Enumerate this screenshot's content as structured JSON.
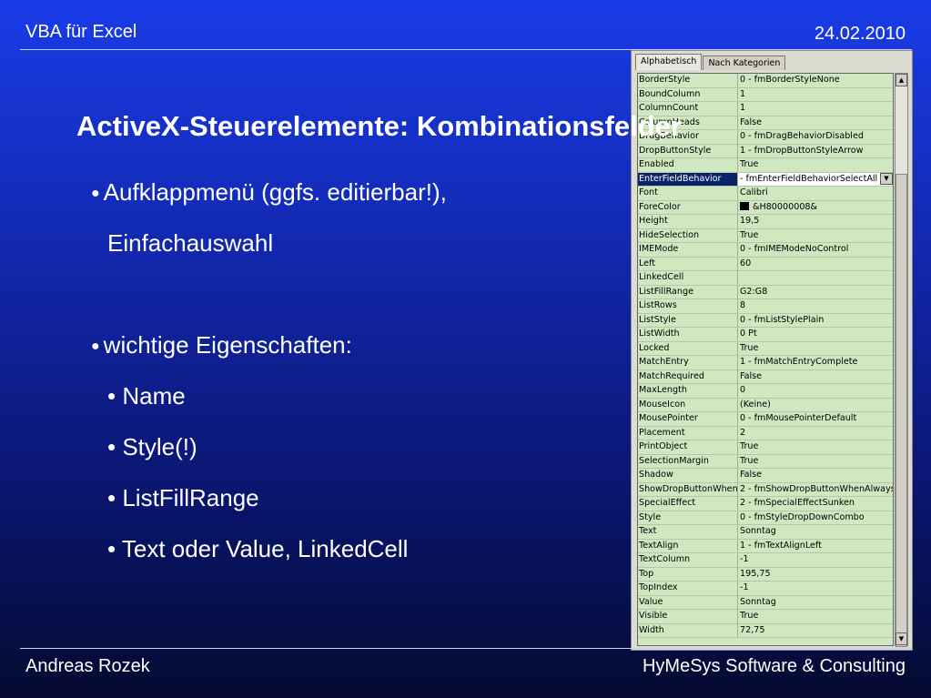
{
  "header": {
    "left": "VBA für Excel",
    "right": "24.02.2010"
  },
  "slide": {
    "title": "ActiveX-Steuerelemente: Kombinationsfelder",
    "bullet1_line1": "Aufklappmenü (ggfs. editierbar!),",
    "bullet1_line2": "Einfachauswahl",
    "bullet2": "wichtige Eigenschaften:",
    "sub": [
      "• Name",
      "• Style(!)",
      "• ListFillRange",
      "• Text oder Value, LinkedCell"
    ]
  },
  "properties": {
    "tabs": [
      "Alphabetisch",
      "Nach Kategorien"
    ],
    "rows": [
      {
        "name": "BorderStyle",
        "value": "0 - fmBorderStyleNone"
      },
      {
        "name": "BoundColumn",
        "value": "1"
      },
      {
        "name": "ColumnCount",
        "value": "1"
      },
      {
        "name": "ColumnHeads",
        "value": "False"
      },
      {
        "name": "DragBehavior",
        "value": "0 - fmDragBehaviorDisabled"
      },
      {
        "name": "DropButtonStyle",
        "value": "1 - fmDropButtonStyleArrow"
      },
      {
        "name": "Enabled",
        "value": "True"
      },
      {
        "name": "EnterFieldBehavior",
        "value": " - fmEnterFieldBehaviorSelectAll"
      },
      {
        "name": "Font",
        "value": "Calibri"
      },
      {
        "name": "ForeColor",
        "value": "&H80000008&"
      },
      {
        "name": "Height",
        "value": "19,5"
      },
      {
        "name": "HideSelection",
        "value": "True"
      },
      {
        "name": "IMEMode",
        "value": "0 - fmIMEModeNoControl"
      },
      {
        "name": "Left",
        "value": "60"
      },
      {
        "name": "LinkedCell",
        "value": ""
      },
      {
        "name": "ListFillRange",
        "value": "G2:G8"
      },
      {
        "name": "ListRows",
        "value": "8"
      },
      {
        "name": "ListStyle",
        "value": "0 - fmListStylePlain"
      },
      {
        "name": "ListWidth",
        "value": "0 Pt"
      },
      {
        "name": "Locked",
        "value": "True"
      },
      {
        "name": "MatchEntry",
        "value": "1 - fmMatchEntryComplete"
      },
      {
        "name": "MatchRequired",
        "value": "False"
      },
      {
        "name": "MaxLength",
        "value": "0"
      },
      {
        "name": "MouseIcon",
        "value": "(Keine)"
      },
      {
        "name": "MousePointer",
        "value": "0 - fmMousePointerDefault"
      },
      {
        "name": "Placement",
        "value": "2"
      },
      {
        "name": "PrintObject",
        "value": "True"
      },
      {
        "name": "SelectionMargin",
        "value": "True"
      },
      {
        "name": "Shadow",
        "value": "False"
      },
      {
        "name": "ShowDropButtonWhen",
        "value": "2 - fmShowDropButtonWhenAlways"
      },
      {
        "name": "SpecialEffect",
        "value": "2 - fmSpecialEffectSunken"
      },
      {
        "name": "Style",
        "value": "0 - fmStyleDropDownCombo"
      },
      {
        "name": "Text",
        "value": "Sonntag"
      },
      {
        "name": "TextAlign",
        "value": "1 - fmTextAlignLeft"
      },
      {
        "name": "TextColumn",
        "value": "-1"
      },
      {
        "name": "Top",
        "value": "195,75"
      },
      {
        "name": "TopIndex",
        "value": "-1"
      },
      {
        "name": "Value",
        "value": "Sonntag"
      },
      {
        "name": "Visible",
        "value": "True"
      },
      {
        "name": "Width",
        "value": "72,75"
      }
    ]
  },
  "footer": {
    "left": "Andreas Rozek",
    "right": "HyMeSys Software & Consulting"
  }
}
